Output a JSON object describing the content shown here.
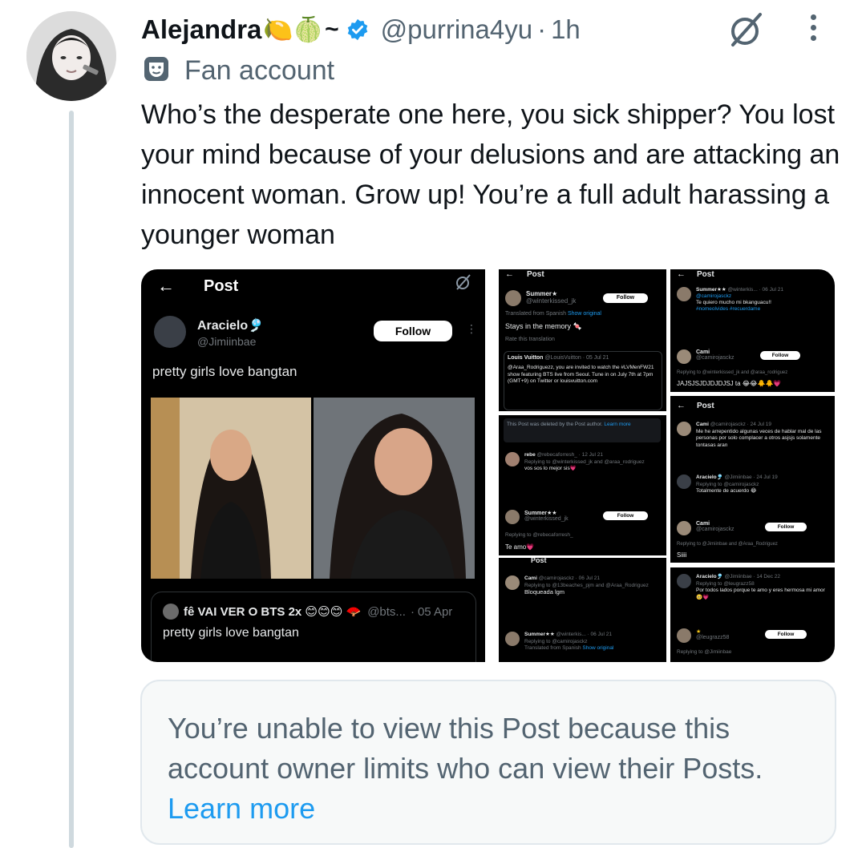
{
  "tweet": {
    "author_name": "Alejandra",
    "author_emoji": "🍋🍈",
    "author_tilde": "~",
    "handle": "@purrina4yu",
    "time_sep": "·",
    "time": "1h",
    "label": "Fan account",
    "text": "Who’s the desperate one here, you sick shipper? You lost your mind because of your delusions and are attacking an innocent woman. Grow up! You’re a full adult harassing a younger woman"
  },
  "colors": {
    "verified": "#1d9bf0",
    "link": "#1d9bf0",
    "muted": "#536471",
    "thread_line": "#cfd9de"
  },
  "icons": {
    "verified": "verified-badge-icon",
    "grok": "grok-icon",
    "more": "more-icon",
    "label": "theater-masks-icon",
    "back": "back-arrow-icon"
  },
  "media": {
    "main": {
      "header_title": "Post",
      "user_name": "Aracielo🎐",
      "user_handle": "@Jimiinbae",
      "follow_label": "Follow",
      "post_text": "pretty girls love bangtan",
      "quoted_name": "fê VAI VER O BTS 2x 😊😊😊 🪭",
      "quoted_handle": "@bts...",
      "quoted_sep": "·",
      "quoted_date": "05 Apr",
      "quoted_text": "pretty girls love bangtan"
    },
    "s1": {
      "header_title": "Post",
      "user_name": "Summer★",
      "user_handle": "@winterkissed_jk",
      "follow_label": "Follow",
      "translated": "Translated from Spanish",
      "show_original": "Show original",
      "text": "Stays in the memory 🍬",
      "rate": "Rate this translation",
      "quoted_name": "Louis Vuitton",
      "quoted_handle": "@LouisVuitton · 05 Jul 21",
      "quoted_text": "@Araa_Rodriguezz, you are invited to watch the #LVMenFW21 show featuring BTS live from Seoul. Tune in on July 7th at 7pm (GMT+9) on Twitter or louisvuitton.com"
    },
    "s2": {
      "header_title": "Post",
      "user1_name": "Summer★★",
      "user1_handle": "@winterkis... · 06 Jul 21",
      "user1_reply": "@camirojasckz",
      "user1_text": "Te quiero mucho mi bkanguacu!!",
      "user1_tags": "#nomeolvides #recuerdame",
      "user2_name": "Cami",
      "user2_handle": "@camirojasckz",
      "follow_label": "Follow",
      "replying": "Replying to @winterkissed_jk and @araa_rodriguez",
      "text": "JAJSJSJDJDJDJSJ ta 😂😂🐥🐥💗"
    },
    "s3": {
      "deleted": "This Post was deleted by the Post author.",
      "learn_more": "Learn more",
      "u1_name": "rebe",
      "u1_handle": "@rebecaforresh_ · 12 Jul 21",
      "u1_reply": "Replying to @winterkissed_jk and @araa_rodriguez",
      "u1_text": "vos sos lo mejor sis💗",
      "u2_name": "Summer★★",
      "u2_handle": "@winterkissed_jk",
      "follow_label": "Follow",
      "u2_reply": "Replying to @rebecaforresh_",
      "u2_text": "Te amo💗"
    },
    "s4": {
      "header_title": "Post",
      "u1_name": "Cami",
      "u1_handle": "@camirojasckz · 24 Jul 19",
      "u1_text": "Me he arrepentido algunas veces de hablar mal de las personas por solo complacer a otros asjsjs solamente tontasas aran",
      "u2_name": "Aracielo🎐",
      "u2_handle": "@Jimiinbae · 24 Jul 19",
      "u2_reply": "Replying to @camirojasckz",
      "u2_text": "Totalmente de acuerdo 😂",
      "u3_name": "Cami",
      "u3_handle": "@camirojasckz",
      "follow_label": "Follow",
      "u3_reply": "Replying to @Jimiinbae and @Araa_Rodriguez",
      "u3_text": "Siiii"
    },
    "s5": {
      "header_title": "Post",
      "u1_name": "Cami",
      "u1_handle": "@camirojasckz · 06 Jul 21",
      "u1_reply": "Replying to @13beaches_pjm and @Araa_Rodriguez",
      "u1_text": "Bloqueada lgm",
      "u2_name": "Summer★★",
      "u2_handle": "@winterkis... · 06 Jul 21",
      "u2_reply": "Replying to @camirojasckz",
      "translated": "Translated from Spanish",
      "show_original": "Show original"
    },
    "s6": {
      "u1_name": "Aracielo🎐",
      "u1_handle": "@Jimiinbae · 14 Dec 22",
      "u1_reply": "Replying to @leugrazz58",
      "u1_text": "Por todos lados porque te amo y eres hermosa mi amor 🥺💗",
      "u2_name": "★",
      "u2_handle": "@leugrazz58",
      "follow_label": "Follow",
      "u2_reply": "Replying to @Jimiinbae"
    }
  },
  "notice": {
    "text": "You’re unable to view this Post because this account owner limits who can view their Posts.",
    "link": "Learn more"
  }
}
